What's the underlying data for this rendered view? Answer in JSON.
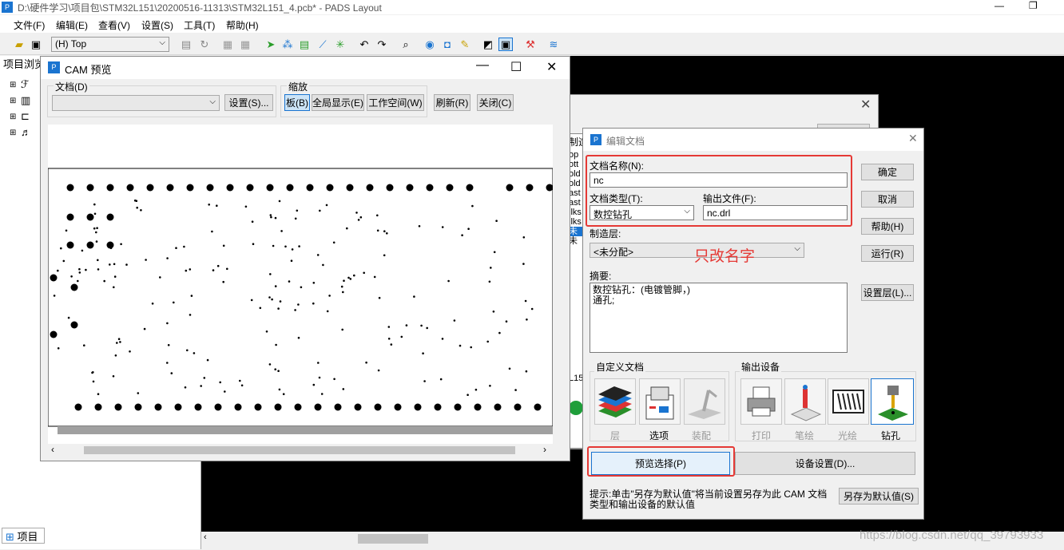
{
  "app": {
    "title": "D:\\硬件学习\\项目包\\STM32L151\\20200516-11313\\STM32L151_4.pcb* - PADS Layout",
    "colors": {
      "canvas": "#000000",
      "highlight": "#e53935",
      "accent": "#1a74d0"
    }
  },
  "menu": [
    "文件(F)",
    "编辑(E)",
    "查看(V)",
    "设置(S)",
    "工具(T)",
    "帮助(H)"
  ],
  "toolbar": {
    "layer": "(H) Top"
  },
  "project_panel": {
    "title": "项目浏览",
    "tab": "项目"
  },
  "cam_preview": {
    "title": "CAM 预览",
    "doc_group": "文档(D)",
    "doc_value": "",
    "settings_btn": "设置(S)...",
    "zoom_group": "缩放",
    "board_btn": "板(B)",
    "fullview_btn": "全局显示(E)",
    "workspace_btn": "工作空间(W)",
    "refresh_btn": "刷新(R)",
    "close_btn": "关闭(C)"
  },
  "bg_dialog": {
    "frag": [
      "制造",
      "op",
      "ott",
      "old",
      "old",
      "ast",
      "ast",
      "ilks",
      "ilks",
      "未",
      "未",
      "L15"
    ]
  },
  "edit_doc": {
    "title": "编辑文档",
    "docname_label": "文档名称(N):",
    "docname_value": "nc",
    "doctype_label": "文档类型(T):",
    "doctype_value": "数控钻孔",
    "outfile_label": "输出文件(F):",
    "outfile_value": "nc.drl",
    "fablayer_label": "制造层:",
    "fablayer_value": "<未分配>",
    "annotation": "只改名字",
    "summary_label": "摘要:",
    "summary_text": "数控钻孔：(电镀管脚，)\n通孔;",
    "ok_btn": "确定",
    "cancel_btn": "取消",
    "help_btn": "帮助(H)",
    "run_btn": "运行(R)",
    "layers_btn": "设置层(L)...",
    "custom_group": "自定义文档",
    "output_group": "输出设备",
    "custom": [
      {
        "name": "层",
        "icon": "layers-icon"
      },
      {
        "name": "选项",
        "icon": "options-icon"
      },
      {
        "name": "装配",
        "icon": "assembly-icon"
      }
    ],
    "devices": [
      {
        "name": "打印",
        "icon": "printer-icon"
      },
      {
        "name": "笔绘",
        "icon": "pen-plotter-icon"
      },
      {
        "name": "光绘",
        "icon": "photo-plotter-icon"
      },
      {
        "name": "钻孔",
        "icon": "drill-icon"
      }
    ],
    "preview_btn": "预览选择(P)",
    "device_btn": "设备设置(D)...",
    "hint": "提示:单击\"另存为默认值\"将当前设置另存为此 CAM 文档类型和输出设备的默认值",
    "save_default_btn": "另存为默认值(S)"
  },
  "watermark": "https://blog.csdn.net/qq_39793933"
}
